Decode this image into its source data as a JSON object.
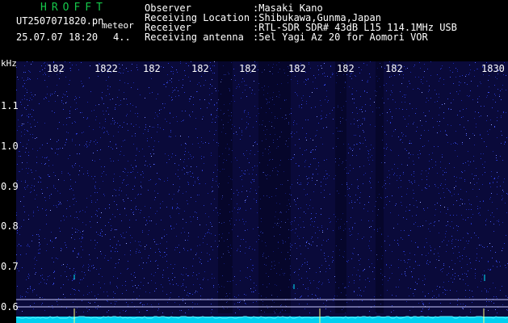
{
  "header": {
    "brand": "HROFFT",
    "filename": "UT2507071820.pn",
    "tag": "meteor",
    "datetime": "25.07.07 18:20",
    "count": "4..",
    "info": [
      {
        "key": "Observer",
        "value": ":Masaki Kano"
      },
      {
        "key": "Receiving Location",
        "value": ":Shibukawa,Gunma,Japan"
      },
      {
        "key": "Receiver",
        "value": ":RTL-SDR SDR# 43dB L15 114.1MHz USB"
      },
      {
        "key": "Receiving antenna",
        "value": ":5el Yagi Az 20 for Aomori VOR"
      }
    ]
  },
  "spectrogram": {
    "y_unit": "kHz",
    "y_ticks": [
      "1.1",
      "1.0",
      "0.9",
      "0.8",
      "0.7",
      "0.6"
    ],
    "x_ticks": [
      "182",
      "1822",
      "182",
      "182",
      "182",
      "182",
      "182",
      "182",
      "1830"
    ],
    "colors": {
      "background": "#0a0a3a",
      "noise": "#2a3bd0",
      "signal": "#00d8ff",
      "text": "#ffffff"
    }
  }
}
